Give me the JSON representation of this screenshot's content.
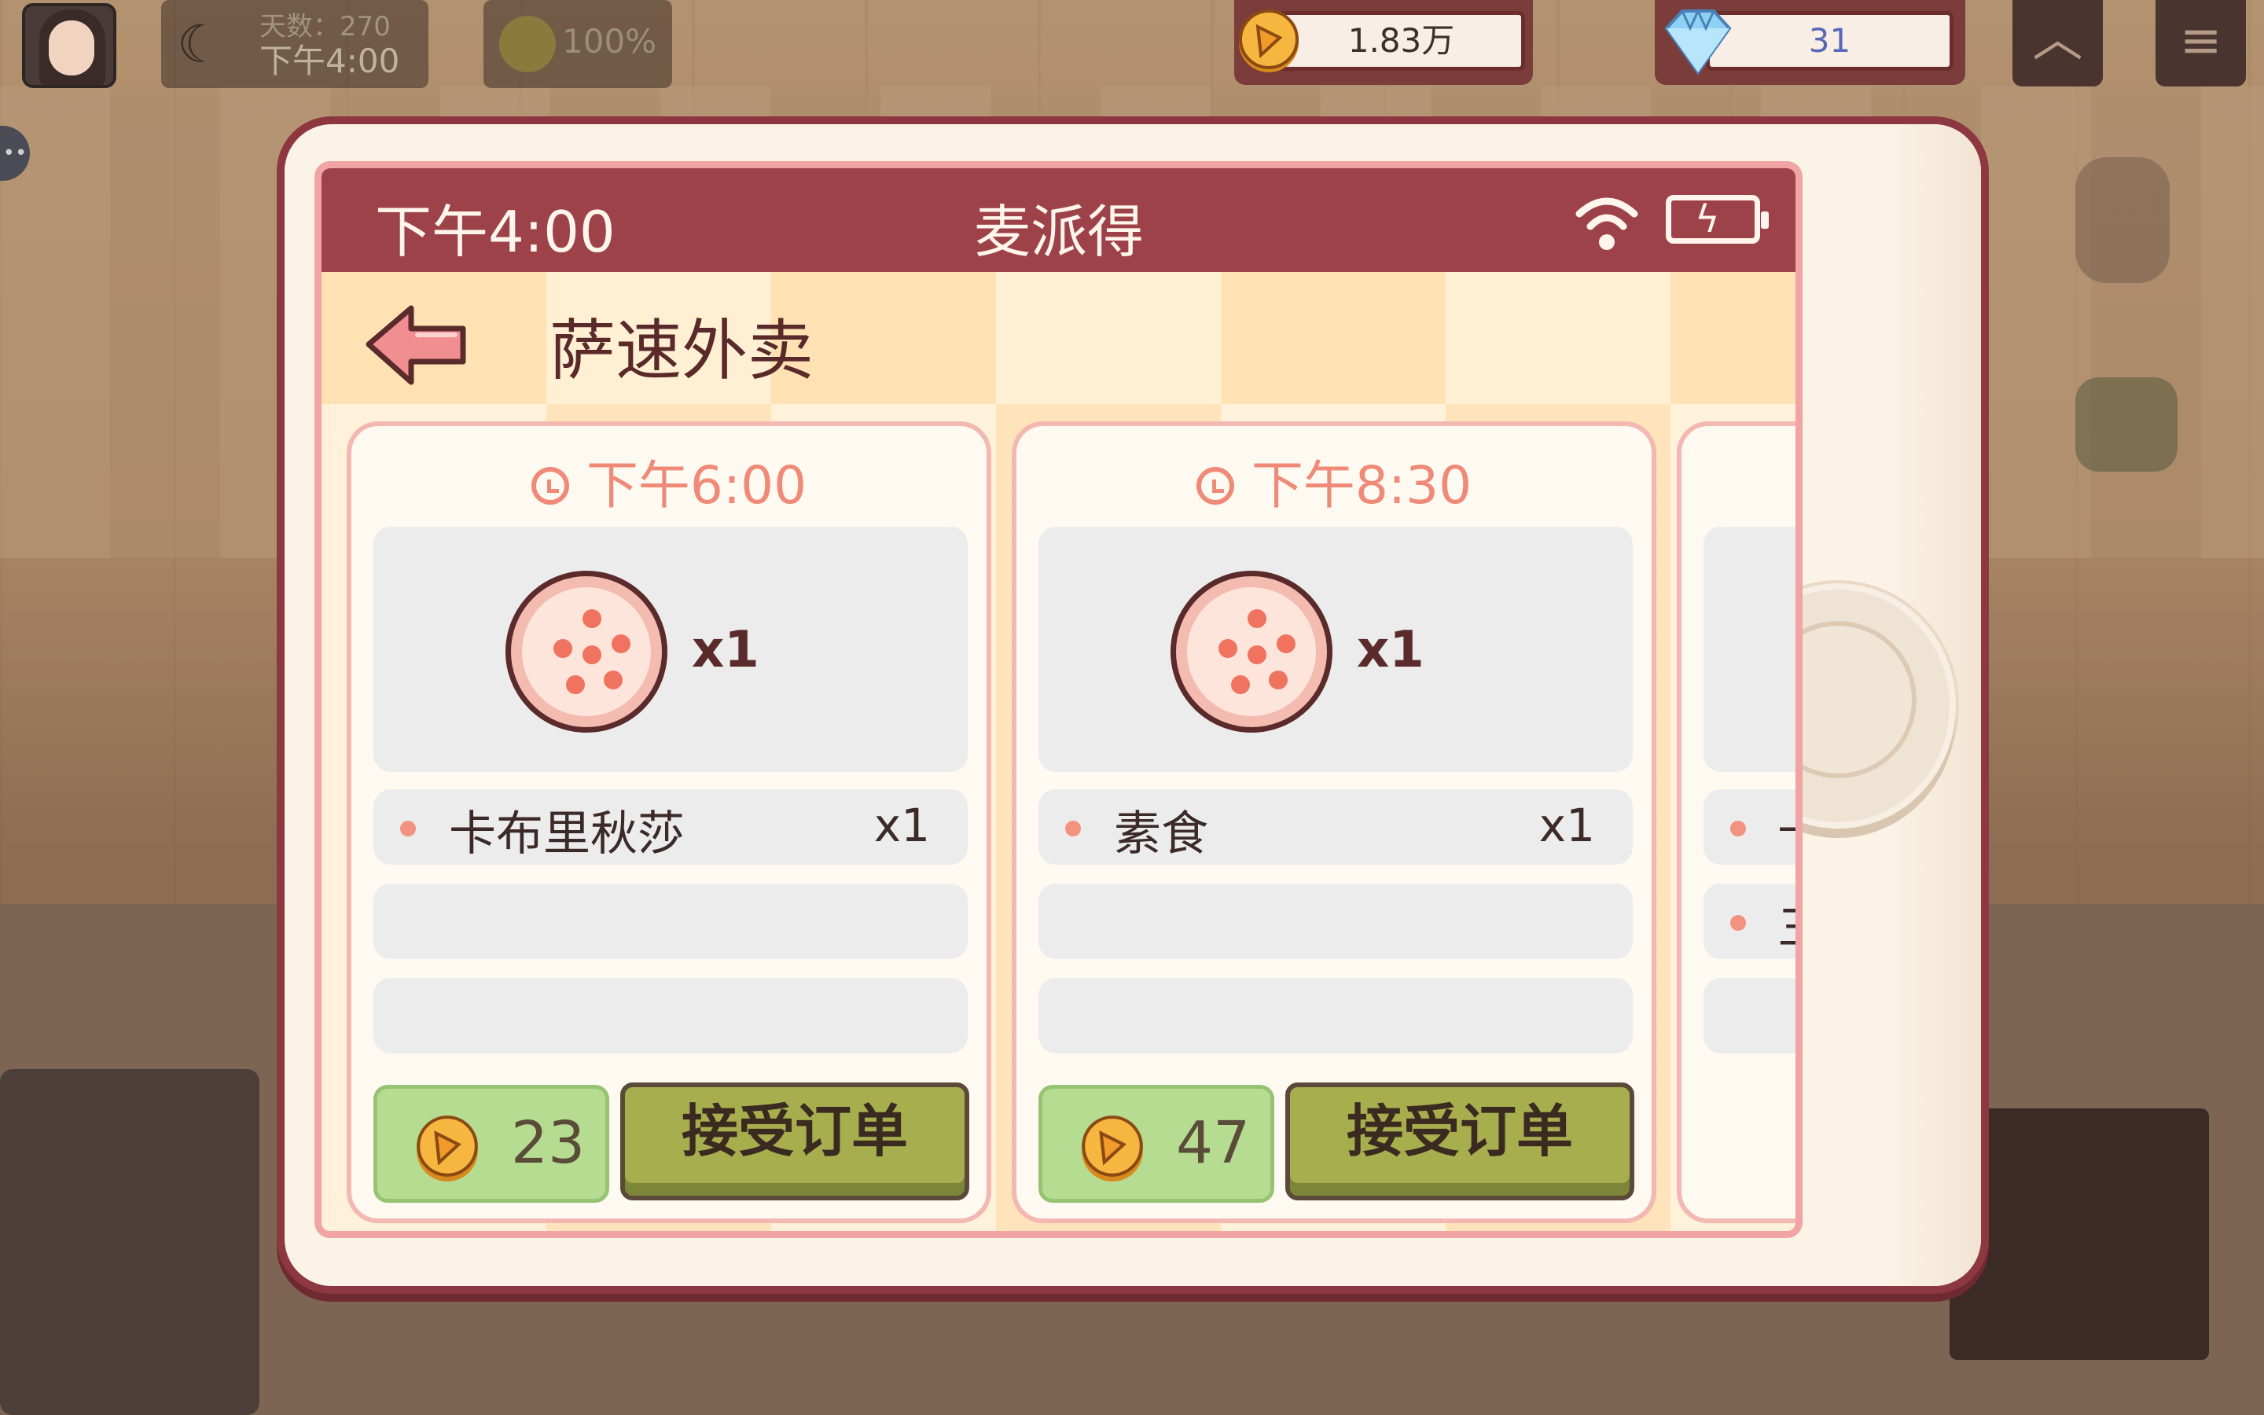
{
  "hud": {
    "day_label": "天数：270",
    "time_label": "下午4:00",
    "mood_percent": "100%",
    "coins": "1.83万",
    "gems": "31"
  },
  "phone": {
    "status_time": "下午4:00",
    "app_title": "麦派得",
    "page_title": "萨速外卖",
    "orders": [
      {
        "time": "下午6:00",
        "quantity_badge": "x1",
        "items": [
          {
            "name": "卡布里秋莎",
            "count": "x1"
          }
        ],
        "reward": "23",
        "accept_label": "接受订单"
      },
      {
        "time": "下午8:30",
        "quantity_badge": "x1",
        "items": [
          {
            "name": "素食",
            "count": "x1"
          }
        ],
        "reward": "47",
        "accept_label": "接受订单"
      },
      {
        "items": [
          {
            "name": "卡"
          },
          {
            "name": "三"
          }
        ]
      }
    ]
  },
  "colors": {
    "status_bar": "#9d4248",
    "accent_time": "#f08a78",
    "accept_button": "#a6ae4e",
    "reward_box": "#b5dc91"
  },
  "icons": [
    "moon-icon",
    "smiley-icon",
    "coin-icon",
    "diamond-icon",
    "chevron-up-icon",
    "menu-icon",
    "wifi-icon",
    "battery-icon",
    "back-arrow-icon",
    "clock-icon",
    "pizza-icon"
  ]
}
